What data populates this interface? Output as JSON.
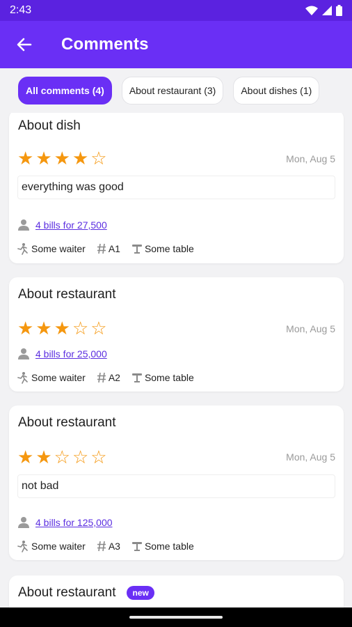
{
  "status_bar": {
    "time": "2:43"
  },
  "app_bar": {
    "title": "Comments"
  },
  "tabs": [
    {
      "label": "All comments (4)",
      "active": true
    },
    {
      "label": "About restaurant (3)",
      "active": false
    },
    {
      "label": "About dishes (1)",
      "active": false
    }
  ],
  "comments": [
    {
      "title": "About dish",
      "rating": 4,
      "max_rating": 5,
      "date": "Mon, Aug 5",
      "text": "everything was good",
      "bills": "4 bills for 27,500",
      "waiter": "Some waiter",
      "table_code": "A1",
      "table": "Some table"
    },
    {
      "title": "About restaurant",
      "rating": 3,
      "max_rating": 5,
      "date": "Mon, Aug 5",
      "bills": "4 bills for 25,000",
      "waiter": "Some waiter",
      "table_code": "A2",
      "table": "Some table"
    },
    {
      "title": "About restaurant",
      "rating": 2,
      "max_rating": 5,
      "date": "Mon, Aug 5",
      "text": "not bad",
      "bills": "4 bills for 125,000",
      "waiter": "Some waiter",
      "table_code": "A3",
      "table": "Some table"
    },
    {
      "title": "About restaurant",
      "badge": "new"
    }
  ],
  "colors": {
    "primary": "#6a2ff5",
    "status_bar": "#5b22e0",
    "star": "#f5970f",
    "link": "#5b2ee0",
    "muted": "#9a9a9a"
  },
  "icons": {
    "back": "arrow-left-icon",
    "wifi": "wifi-icon",
    "signal": "signal-icon",
    "battery": "battery-icon",
    "person": "person-icon",
    "waiter": "waiter-icon",
    "hash": "hash-icon",
    "table": "table-icon",
    "star": "star-icon"
  }
}
